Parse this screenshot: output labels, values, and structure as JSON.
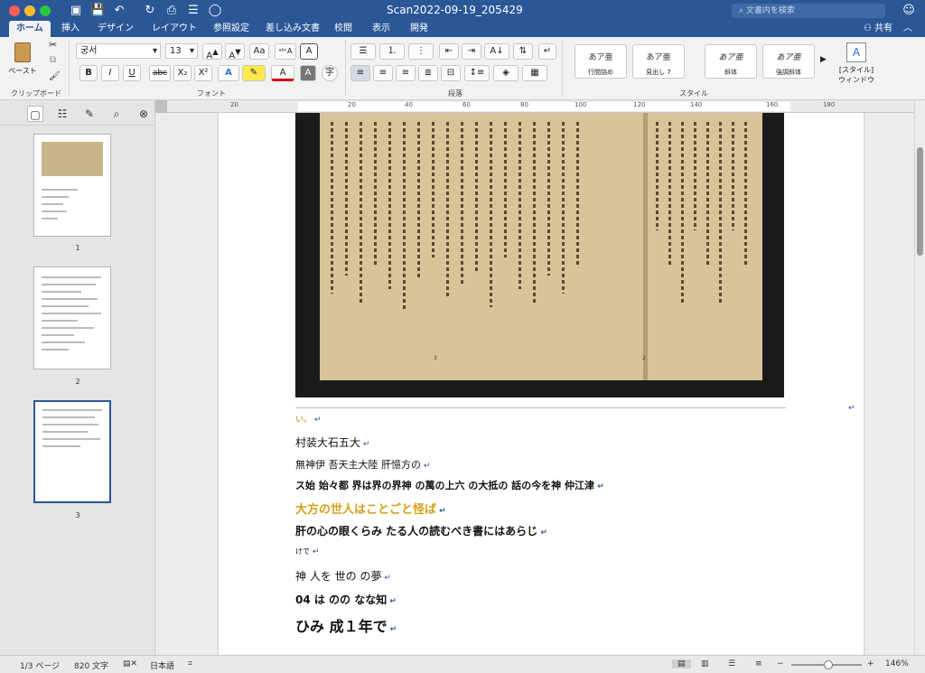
{
  "window": {
    "title": "Scan2022-09-19_205429",
    "search_placeholder": "文書内を検索"
  },
  "quick_access": [
    "sidebar-icon",
    "save-icon",
    "undo-icon",
    "redo-icon",
    "print-icon",
    "format-icon",
    "circle-icon"
  ],
  "tabs": [
    "ホーム",
    "挿入",
    "デザイン",
    "レイアウト",
    "参照設定",
    "差し込み文書",
    "校閲",
    "表示",
    "開発"
  ],
  "share": "共有",
  "ribbon": {
    "clipboard": {
      "paste": "ペースト",
      "group": "クリップボード"
    },
    "font": {
      "name": "궁서",
      "size": "13",
      "group": "フォント",
      "buttons": [
        "B",
        "I",
        "U",
        "abc",
        "X₂",
        "X²"
      ]
    },
    "paragraph": {
      "group": "段落"
    },
    "styles": {
      "group": "スタイル",
      "items": [
        {
          "preview": "あア亜",
          "label": "行間詰め"
        },
        {
          "preview": "あア亜",
          "label": "見出し 7"
        },
        {
          "preview": "あア亜",
          "label": "斜体"
        },
        {
          "preview": "あア亜",
          "label": "強調斜体"
        }
      ]
    },
    "styles_pane": {
      "line1": "[スタイル]",
      "line2": "ウィンドウ"
    }
  },
  "ruler": {
    "ticks": [
      "20",
      "20",
      "40",
      "60",
      "80",
      "100",
      "120",
      "140",
      "160",
      "180"
    ]
  },
  "thumbnails": [
    {
      "num": "1"
    },
    {
      "num": "2"
    },
    {
      "num": "3"
    }
  ],
  "document": {
    "scan_page_numbers": [
      "3",
      "2"
    ],
    "lines": [
      {
        "text": "い。",
        "color": "#b8860b",
        "size": 9,
        "bold": false
      },
      {
        "text": "村装大石五大",
        "color": "#111",
        "size": 12,
        "bold": false
      },
      {
        "text": "無神伊 吾天主大陸 肝憶方の",
        "color": "#111",
        "size": 11,
        "bold": false
      },
      {
        "text": "ス始 始々都 界は界の界神 の萬の上六 の大抵の 話の今を神 仲江津",
        "color": "#111",
        "size": 11,
        "bold": true
      },
      {
        "text": "大方の世人はことごと怪ば",
        "color": "#d4a017",
        "size": 13,
        "bold": true
      },
      {
        "text": "肝の心の眼くらみ たる人の読むべき書にはあらじ",
        "color": "#111",
        "size": 12,
        "bold": true
      },
      {
        "text": "けで",
        "color": "#111",
        "size": 8,
        "bold": false
      },
      {
        "text": "神 人を 世の の夢",
        "color": "#111",
        "size": 12,
        "bold": false
      },
      {
        "text": "04 は のの なな知",
        "color": "#111",
        "size": 12,
        "bold": true
      },
      {
        "text": "ひみ 成１年で",
        "color": "#111",
        "size": 16,
        "bold": true
      }
    ]
  },
  "status": {
    "page": "1/3 ページ",
    "words": "820 文字",
    "language": "日本語",
    "zoom": "146%"
  }
}
